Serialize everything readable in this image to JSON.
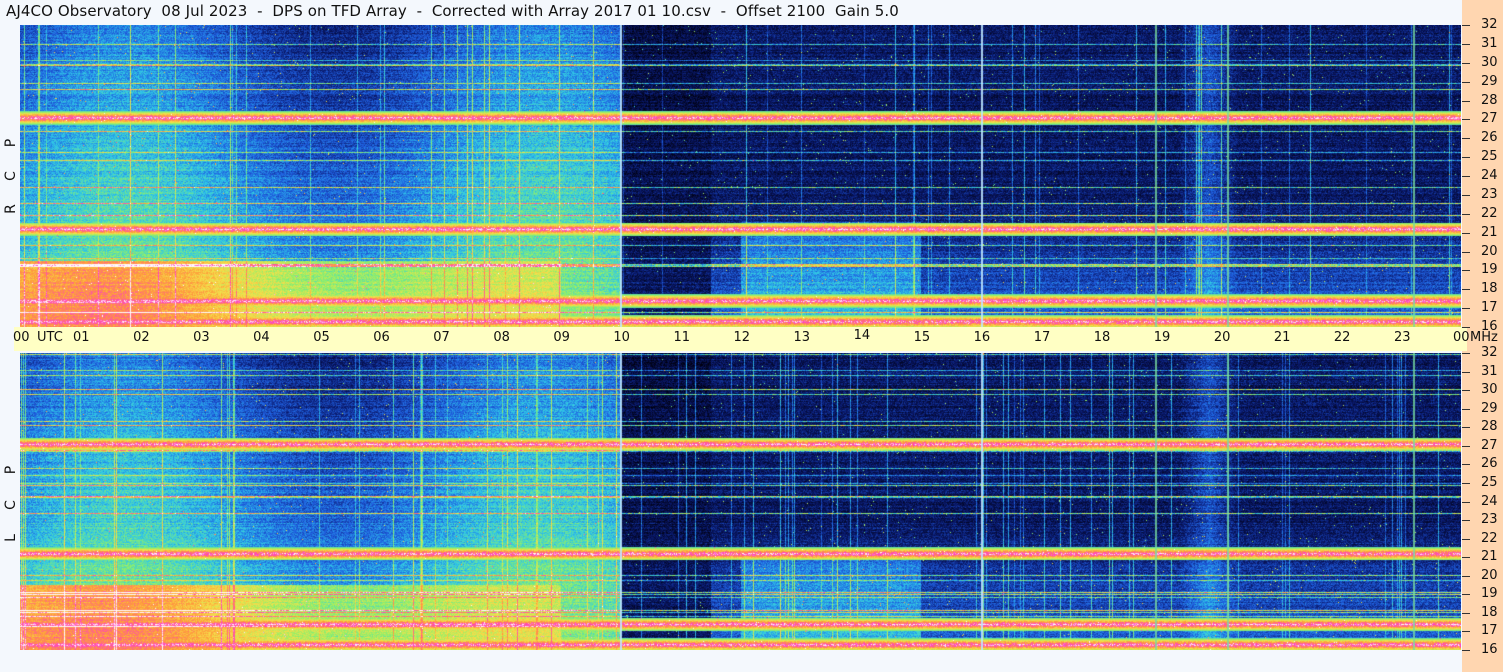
{
  "title": "AJ4CO Observatory  08 Jul 2023  -  DPS on TFD Array  -  Corrected with Array 2017 01 10.csv  -  Offset 2100  Gain 5.0",
  "panels": [
    {
      "id": "rcp",
      "letters": [
        "R",
        "C",
        "P"
      ]
    },
    {
      "id": "lcp",
      "letters": [
        "L",
        "C",
        "P"
      ]
    }
  ],
  "colors": {
    "background": "#000000",
    "time_bar": "#ffffc4",
    "freq_column": "#ffd6b0",
    "text": "#111111"
  },
  "chart_data": {
    "type": "heatmap",
    "title": "AJ4CO Observatory  08 Jul 2023  -  DPS on TFD Array  -  Corrected with Array 2017 01 10.csv  -  Offset 2100  Gain 5.0",
    "colormap": [
      "#000010",
      "#0a1a6e",
      "#1f5fe0",
      "#2fc8e8",
      "#8ef06a",
      "#f5e04a",
      "#ff9a3a",
      "#ff40c0",
      "#ffffff"
    ],
    "x_axis": {
      "unit": "UTC",
      "ticks": [
        "00",
        "01",
        "02",
        "03",
        "04",
        "05",
        "06",
        "07",
        "08",
        "09",
        "10",
        "11",
        "12",
        "13",
        "14",
        "15",
        "16",
        "17",
        "18",
        "19",
        "20",
        "21",
        "22",
        "23",
        "00"
      ],
      "range": [
        0,
        24
      ]
    },
    "y_axis": {
      "unit": "MHz",
      "ticks": [
        "32",
        "31",
        "30",
        "29",
        "28",
        "27",
        "26",
        "25",
        "24",
        "23",
        "22",
        "21",
        "20",
        "19",
        "18",
        "17",
        "16"
      ],
      "range": [
        16,
        32
      ]
    },
    "series": [
      {
        "name": "RCP"
      },
      {
        "name": "LCP"
      }
    ],
    "vertical_markers_utc": [
      10.0,
      16.0,
      18.9,
      20.1,
      23.2
    ],
    "strong_bands_mhz": [
      27.1,
      21.2,
      17.4,
      16.3
    ],
    "grid": false
  }
}
